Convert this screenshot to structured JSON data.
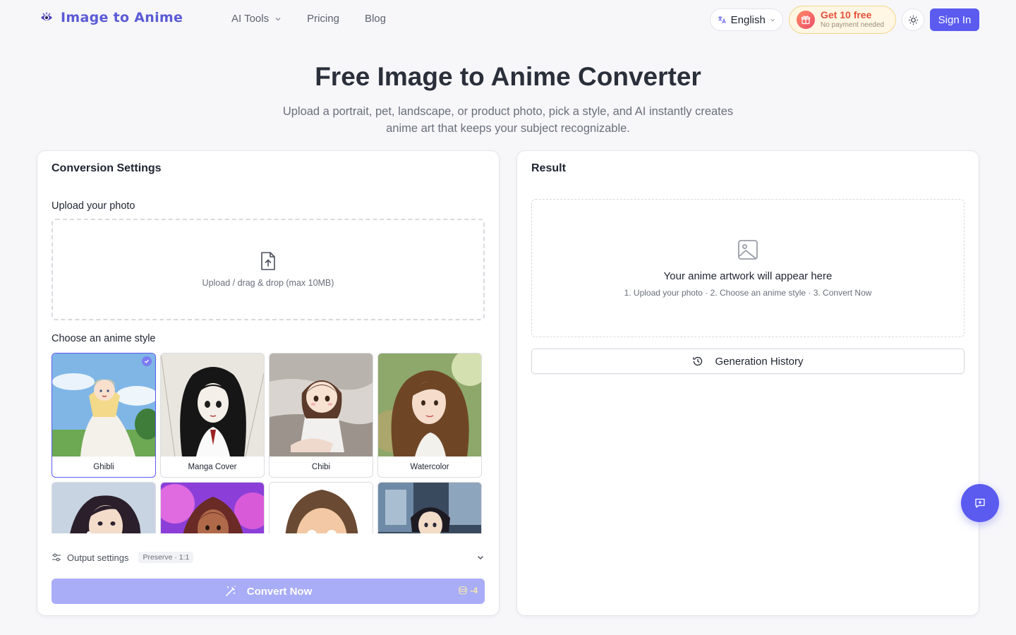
{
  "header": {
    "logo_text": "Image to Anime",
    "nav": [
      {
        "label": "AI Tools",
        "has_dropdown": true
      },
      {
        "label": "Pricing"
      },
      {
        "label": "Blog"
      }
    ],
    "language": "English",
    "promo_main": "Get 10 free",
    "promo_sub": "No payment needed",
    "signin_label": "Sign In"
  },
  "hero": {
    "title": "Free Image to Anime Converter",
    "subtitle_line1": "Upload a portrait, pet, landscape, or product photo, pick a style, and AI instantly creates",
    "subtitle_line2": "anime art that keeps your subject recognizable."
  },
  "settings": {
    "title": "Conversion Settings",
    "upload_label": "Upload your photo",
    "upload_hint": "Upload / drag & drop (max 10MB)",
    "style_label": "Choose an anime style",
    "styles": [
      {
        "name": "Ghibli",
        "selected": true
      },
      {
        "name": "Manga Cover",
        "selected": false
      },
      {
        "name": "Chibi",
        "selected": false
      },
      {
        "name": "Watercolor",
        "selected": false
      },
      {
        "name": "",
        "selected": false
      },
      {
        "name": "",
        "selected": false
      },
      {
        "name": "",
        "selected": false
      },
      {
        "name": "",
        "selected": false
      }
    ],
    "output_label": "Output settings",
    "output_badge": "Preserve · 1:1",
    "convert_label": "Convert Now",
    "convert_cost": "-4"
  },
  "result": {
    "title": "Result",
    "placeholder_title": "Your anime artwork will appear here",
    "placeholder_steps": "1. Upload your photo · 2. Choose an anime style · 3. Convert Now",
    "history_label": "Generation History"
  },
  "icons": {
    "logo": "eye-logo-icon",
    "upload": "file-upload-icon",
    "image": "image-placeholder-icon",
    "history": "history-icon",
    "wand": "magic-wand-icon",
    "coins": "coins-icon",
    "theme": "sun-icon",
    "translate": "translate-icon",
    "gift": "gift-icon",
    "sliders": "sliders-icon",
    "chat": "chat-plus-icon"
  },
  "colors": {
    "accent": "#5b5bf0",
    "promo_text": "#e8503a",
    "convert_disabled": "#a9acf6"
  }
}
